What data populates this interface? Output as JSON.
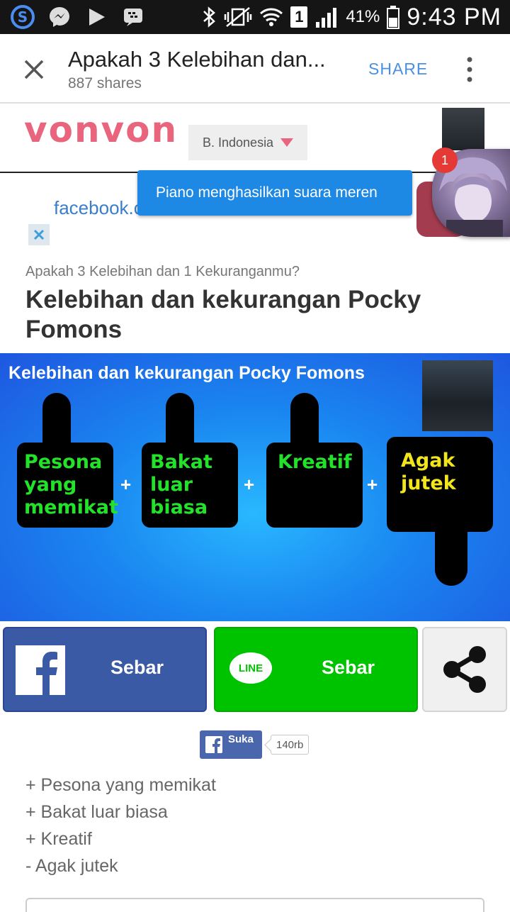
{
  "status_bar": {
    "battery_percent": "41%",
    "time": "9:43 PM",
    "sim_slot": "1"
  },
  "toolbar": {
    "title": "Apakah 3 Kelebihan dan...",
    "subtitle": "887 shares",
    "share_label": "SHARE"
  },
  "site": {
    "logo": "vonvon",
    "language": "B. Indonesia"
  },
  "ad": {
    "link_text": "facebook.c"
  },
  "chat_head": {
    "tooltip": "Piano menghasilkan suara meren",
    "badge": "1"
  },
  "article": {
    "kicker": "Apakah 3 Kelebihan dan 1 Kekuranganmu?",
    "headline": "Kelebihan dan kekurangan Pocky Fomons"
  },
  "banner": {
    "title": "Kelebihan dan kekurangan Pocky Fomons",
    "hands": [
      {
        "text": "Pesona yang memikat",
        "color": "#22e22a"
      },
      {
        "text": "Bakat luar biasa",
        "color": "#22e22a"
      },
      {
        "text": "Kreatif",
        "color": "#22e22a"
      },
      {
        "text": "Agak jutek",
        "color": "#f2e51c"
      }
    ]
  },
  "share_buttons": {
    "facebook_label": "Sebar",
    "line_label": "Sebar",
    "line_logo": "LINE"
  },
  "like": {
    "label": "Suka",
    "count": "140rb"
  },
  "traits": [
    "+ Pesona yang memikat",
    "+ Bakat luar biasa",
    "+ Kreatif",
    "- Agak jutek"
  ],
  "colors": {
    "facebook_blue": "#3b5aa5",
    "line_green": "#00c300",
    "vonvon_pink": "#e8657d",
    "tooltip_blue": "#1e88e5"
  }
}
